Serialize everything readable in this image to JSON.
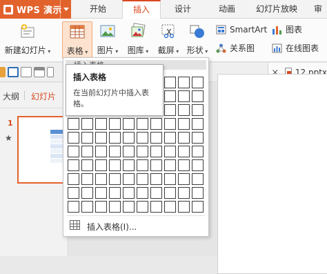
{
  "app": {
    "title": "WPS 演示"
  },
  "tabs": [
    {
      "label": "开始",
      "active": false
    },
    {
      "label": "插入",
      "active": true
    },
    {
      "label": "设计",
      "active": false
    },
    {
      "label": "动画",
      "active": false
    },
    {
      "label": "幻灯片放映",
      "active": false
    },
    {
      "label": "审",
      "active": false
    }
  ],
  "ribbon": {
    "new_slide": "新建幻灯片",
    "table": "表格",
    "picture": "图片",
    "gallery": "图库",
    "screenshot": "截屏",
    "shape": "形状",
    "smartart": "SmartArt",
    "chart": "图表",
    "relation_chart": "关系图",
    "online_chart": "在线图表"
  },
  "document": {
    "tab_name": "12.pptx",
    "close_symbol": "×"
  },
  "left_panel": {
    "tab_outline": "大纲",
    "tab_slides": "幻灯片",
    "slide_number": "1",
    "star_symbol": "★"
  },
  "dropdown": {
    "header": "插入表格",
    "grid_rows": 10,
    "grid_cols": 10,
    "insert_table_label": "插入表格(I)..."
  },
  "tooltip": {
    "title": "插入表格",
    "body": "在当前幻灯片中插入表格。"
  },
  "colors": {
    "accent": "#e2622c",
    "active_tab_text": "#d9481f",
    "selected_button_bg": "#fde3cf"
  }
}
